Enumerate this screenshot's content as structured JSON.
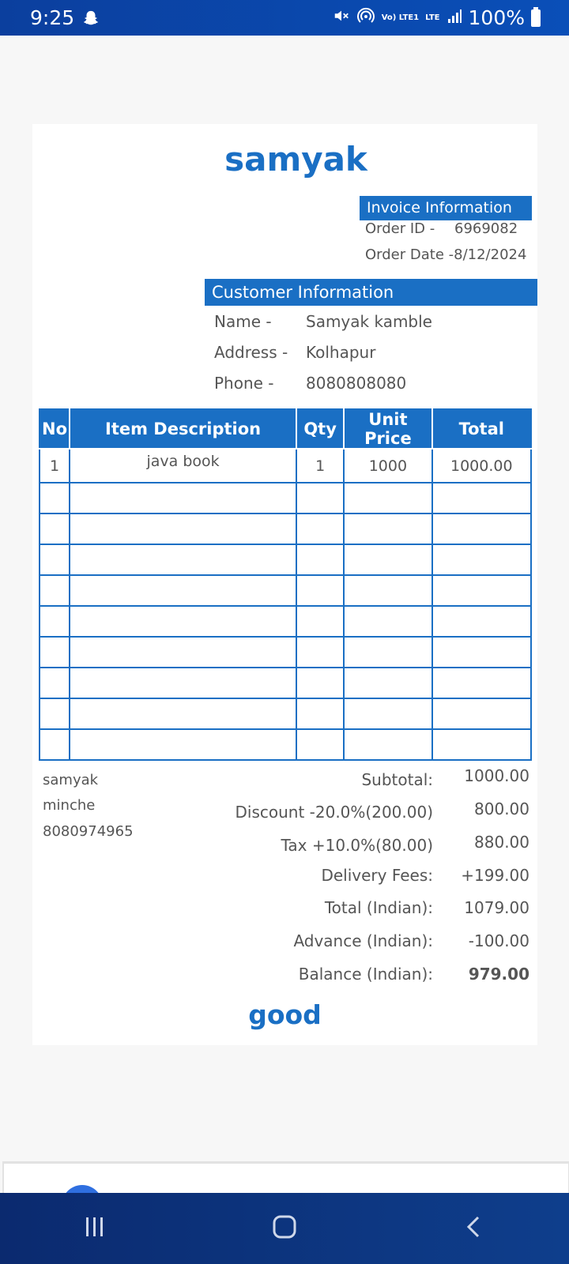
{
  "status_bar": {
    "time": "9:25",
    "battery": "100%",
    "icons": [
      "snapchat-icon",
      "mute-icon",
      "hotspot-icon",
      "volte-icon",
      "lte-icon",
      "signal-icon",
      "battery-icon"
    ],
    "volte_label": "Vo) LTE1",
    "lte_label": "LTE"
  },
  "invoice": {
    "shop_name": "samyak",
    "invoice_info": {
      "header": "Invoice Information",
      "order_id_label": "Order ID -",
      "order_id": "6969082",
      "order_date_label": "Order Date -",
      "order_date": "8/12/2024"
    },
    "customer_info": {
      "header": "Customer Information",
      "name_label": "Name -",
      "name": "Samyak kamble",
      "address_label": "Address -",
      "address": "Kolhapur",
      "phone_label": "Phone -",
      "phone": "8080808080"
    },
    "table": {
      "headers": [
        "No",
        "Item Description",
        "Qty",
        "Unit Price",
        "Total"
      ],
      "rows": [
        [
          "1",
          "java book",
          "1",
          "1000",
          "1000.00"
        ],
        [
          "",
          "",
          "",
          "",
          ""
        ],
        [
          "",
          "",
          "",
          "",
          ""
        ],
        [
          "",
          "",
          "",
          "",
          ""
        ],
        [
          "",
          "",
          "",
          "",
          ""
        ],
        [
          "",
          "",
          "",
          "",
          ""
        ],
        [
          "",
          "",
          "",
          "",
          ""
        ],
        [
          "",
          "",
          "",
          "",
          ""
        ],
        [
          "",
          "",
          "",
          "",
          ""
        ],
        [
          "",
          "",
          "",
          "",
          ""
        ]
      ]
    },
    "seller": {
      "name": "samyak",
      "line2": "minche",
      "phone": "8080974965"
    },
    "totals": {
      "subtotal_label": "Subtotal:",
      "subtotal": "1000.00",
      "discount_label": "Discount -20.0%(200.00)",
      "discount": "800.00",
      "tax_label": "Tax +10.0%(80.00)",
      "tax": "880.00",
      "delivery_label": "Delivery Fees:",
      "delivery": "+199.00",
      "total_label": "Total (Indian):",
      "total": "1079.00",
      "advance_label": "Advance (Indian):",
      "advance": "-100.00",
      "balance_label": "Balance (Indian):",
      "balance": "979.00"
    },
    "footer_note": "good"
  },
  "nav": {
    "buttons": [
      "recents-icon",
      "home-icon",
      "back-icon"
    ]
  },
  "colors": {
    "accent": "#1a6fc4",
    "status_bar": "#0a4fb8",
    "nav_bar": "#0e3e8c",
    "fab": "#2f6fe0"
  }
}
